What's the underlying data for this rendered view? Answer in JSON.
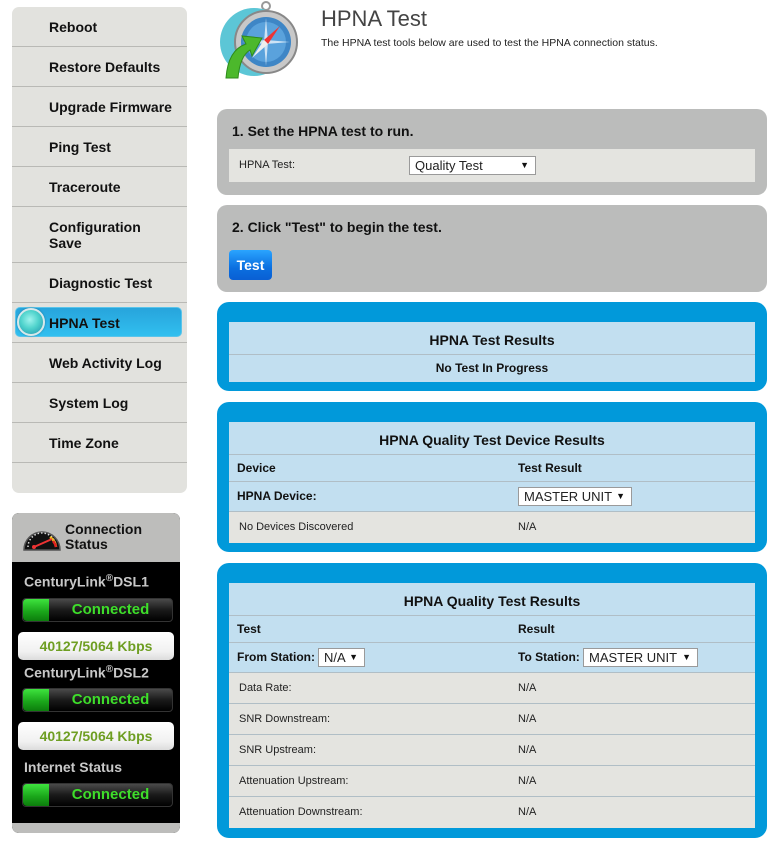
{
  "sidebar": {
    "items": [
      {
        "label": "Reboot",
        "active": false
      },
      {
        "label": "Restore Defaults",
        "active": false
      },
      {
        "label": "Upgrade Firmware",
        "active": false
      },
      {
        "label": "Ping Test",
        "active": false
      },
      {
        "label": "Traceroute",
        "active": false
      },
      {
        "label": "Configuration Save",
        "active": false
      },
      {
        "label": "Diagnostic Test",
        "active": false
      },
      {
        "label": "HPNA Test",
        "active": true
      },
      {
        "label": "Web Activity Log",
        "active": false
      },
      {
        "label": "System Log",
        "active": false
      },
      {
        "label": "Time Zone",
        "active": false
      }
    ]
  },
  "connection_status": {
    "title_line1": "Connection",
    "title_line2": "Status",
    "gauge_icon": "speedometer-icon",
    "dsl1": {
      "brand": "CenturyLink",
      "reg": "®",
      "suffix": "DSL1",
      "status": "Connected",
      "speed": "40127/5064 Kbps"
    },
    "dsl2": {
      "brand": "CenturyLink",
      "reg": "®",
      "suffix": "DSL2",
      "status": "Connected",
      "speed": "40127/5064 Kbps"
    },
    "internet": {
      "label": "Internet Status",
      "status": "Connected"
    }
  },
  "header": {
    "icon": "compass-arrow-icon",
    "title": "HPNA Test",
    "description": "The HPNA test tools below are used to test the HPNA connection status."
  },
  "step1": {
    "title": "1. Set the HPNA test to run.",
    "field_label": "HPNA Test:",
    "select_value": "Quality Test"
  },
  "step2": {
    "title": "2. Click \"Test\" to begin the test.",
    "button_label": "Test"
  },
  "test_results": {
    "title": "HPNA Test Results",
    "status": "No Test In Progress"
  },
  "device_results": {
    "title": "HPNA Quality Test Device Results",
    "col1": "Device",
    "col2": "Test Result",
    "device_label": "HPNA Device:",
    "device_select": "MASTER UNIT",
    "rows": [
      {
        "device": "No Devices Discovered",
        "result": "N/A"
      }
    ]
  },
  "quality_results": {
    "title": "HPNA Quality Test Results",
    "col1": "Test",
    "col2": "Result",
    "from_label": "From Station:",
    "from_value": "N/A",
    "to_label": "To Station:",
    "to_value": "MASTER UNIT",
    "rows": [
      {
        "test": "Data Rate:",
        "result": "N/A"
      },
      {
        "test": "SNR Downstream:",
        "result": "N/A"
      },
      {
        "test": "SNR Upstream:",
        "result": "N/A"
      },
      {
        "test": "Attenuation Upstream:",
        "result": "N/A"
      },
      {
        "test": "Attenuation Downstream:",
        "result": "N/A"
      }
    ]
  },
  "colors": {
    "accent_blue": "#0199da",
    "table_blue": "#c2dff0",
    "connected_green": "#3ede2a",
    "speed_green": "#6e9e22"
  }
}
